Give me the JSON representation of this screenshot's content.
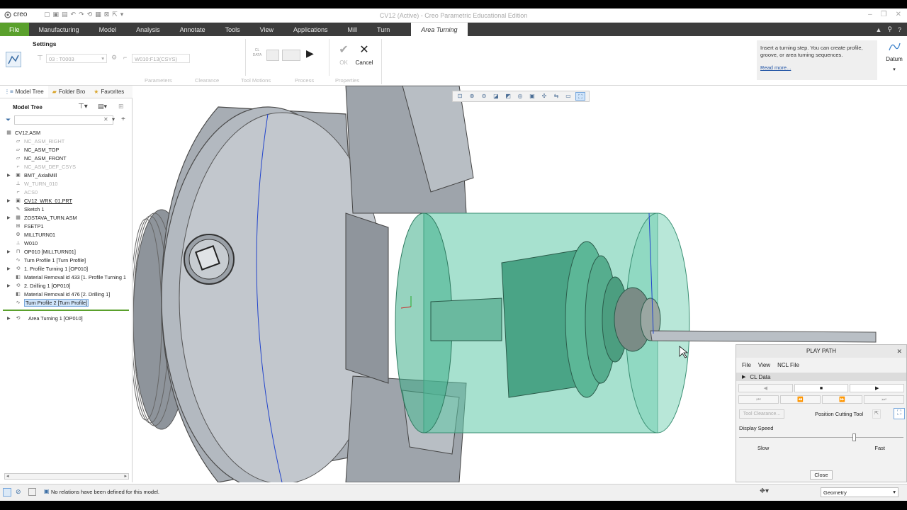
{
  "app": {
    "logo_text": "creo",
    "window_title": "CV12 (Active) - Creo Parametric Educational Edition"
  },
  "ribbon_tabs": [
    "File",
    "Manufacturing",
    "Model",
    "Analysis",
    "Annotate",
    "Tools",
    "View",
    "Applications",
    "Mill",
    "Turn"
  ],
  "active_tab": "Area Turning",
  "settings": {
    "group_title": "Settings",
    "tool_select": "03 : T0003",
    "csys_field": "W010:F13(CSYS)",
    "ok_label": "OK",
    "cancel_label": "Cancel",
    "sub_tabs": [
      "Parameters",
      "Clearance",
      "Tool Motions",
      "Process",
      "Properties"
    ],
    "cldata_icon_label": "CL DATA"
  },
  "info_panel": {
    "text": "Insert a turning step. You can create profile, groove, or area turning sequences.",
    "read_more": "Read more...",
    "datum_label": "Datum"
  },
  "left_panel": {
    "tabs": [
      "Model Tree",
      "Folder Bro",
      "Favorites"
    ],
    "tree_title": "Model Tree",
    "items": [
      {
        "label": "CV12.ASM",
        "dim": false,
        "expand": false,
        "icon": "assembly-icon"
      },
      {
        "label": "NC_ASM_RIGHT",
        "dim": true,
        "expand": false,
        "icon": "datum-plane-icon"
      },
      {
        "label": "NC_ASM_TOP",
        "dim": false,
        "expand": false,
        "icon": "datum-plane-icon"
      },
      {
        "label": "NC_ASM_FRONT",
        "dim": false,
        "expand": false,
        "icon": "datum-plane-icon"
      },
      {
        "label": "NC_ASM_DEF_CSYS",
        "dim": true,
        "expand": false,
        "icon": "csys-icon"
      },
      {
        "label": "BMT_AxialMill",
        "dim": false,
        "expand": true,
        "icon": "part-icon"
      },
      {
        "label": "W_TURN_010",
        "dim": true,
        "expand": false,
        "icon": "workcell-icon"
      },
      {
        "label": "ACS0",
        "dim": true,
        "expand": false,
        "icon": "csys-icon"
      },
      {
        "label": "CV12_WRK_01.PRT",
        "dim": false,
        "expand": true,
        "icon": "part-icon",
        "underline": true
      },
      {
        "label": "Sketch 1",
        "dim": false,
        "expand": false,
        "icon": "sketch-icon"
      },
      {
        "label": "ZOSTAVA_TURN.ASM",
        "dim": false,
        "expand": true,
        "icon": "assembly-icon"
      },
      {
        "label": "FSETP1",
        "dim": false,
        "expand": false,
        "icon": "fixture-icon"
      },
      {
        "label": "MILLTURN01",
        "dim": false,
        "expand": false,
        "icon": "machine-icon"
      },
      {
        "label": "W010",
        "dim": false,
        "expand": false,
        "icon": "workcell-icon"
      },
      {
        "label": "OP010 [MILLTURN01]",
        "dim": false,
        "expand": true,
        "icon": "operation-icon"
      },
      {
        "label": "Turn Profile 1 [Turn Profile]",
        "dim": false,
        "expand": false,
        "icon": "turn-profile-icon"
      },
      {
        "label": "1. Profile Turning 1 [OP010]",
        "dim": false,
        "expand": true,
        "icon": "sequence-icon"
      },
      {
        "label": "Material Removal id 433 [1. Profile Turning 1",
        "dim": false,
        "expand": false,
        "icon": "material-removal-icon"
      },
      {
        "label": "2. Drilling 1 [OP010]",
        "dim": false,
        "expand": true,
        "icon": "sequence-icon"
      },
      {
        "label": "Material Removal id 476 [2. Drilling 1]",
        "dim": false,
        "expand": false,
        "icon": "material-removal-icon"
      },
      {
        "label": "Turn Profile 2 [Turn Profile]",
        "dim": false,
        "expand": false,
        "icon": "turn-profile-icon",
        "selected": true
      }
    ],
    "insert_item": "Area Turning 1 [OP010]"
  },
  "play_path": {
    "title": "PLAY PATH",
    "menu": [
      "File",
      "View",
      "NCL File"
    ],
    "cl_data": "CL Data",
    "tool_clearance": "Tool Clearance...",
    "position_cutting_tool": "Position Cutting Tool",
    "display_speed": "Display Speed",
    "slow": "Slow",
    "fast": "Fast",
    "close": "Close",
    "speed_fraction": 0.7
  },
  "status": {
    "message": "No relations have been defined for this model.",
    "filter_value": "Geometry"
  },
  "colors": {
    "file_tab": "#5aa02c",
    "ribbon_bar": "#3c3c3c",
    "selection": "#cfe4fa",
    "workpiece": "#4fc0a0"
  }
}
